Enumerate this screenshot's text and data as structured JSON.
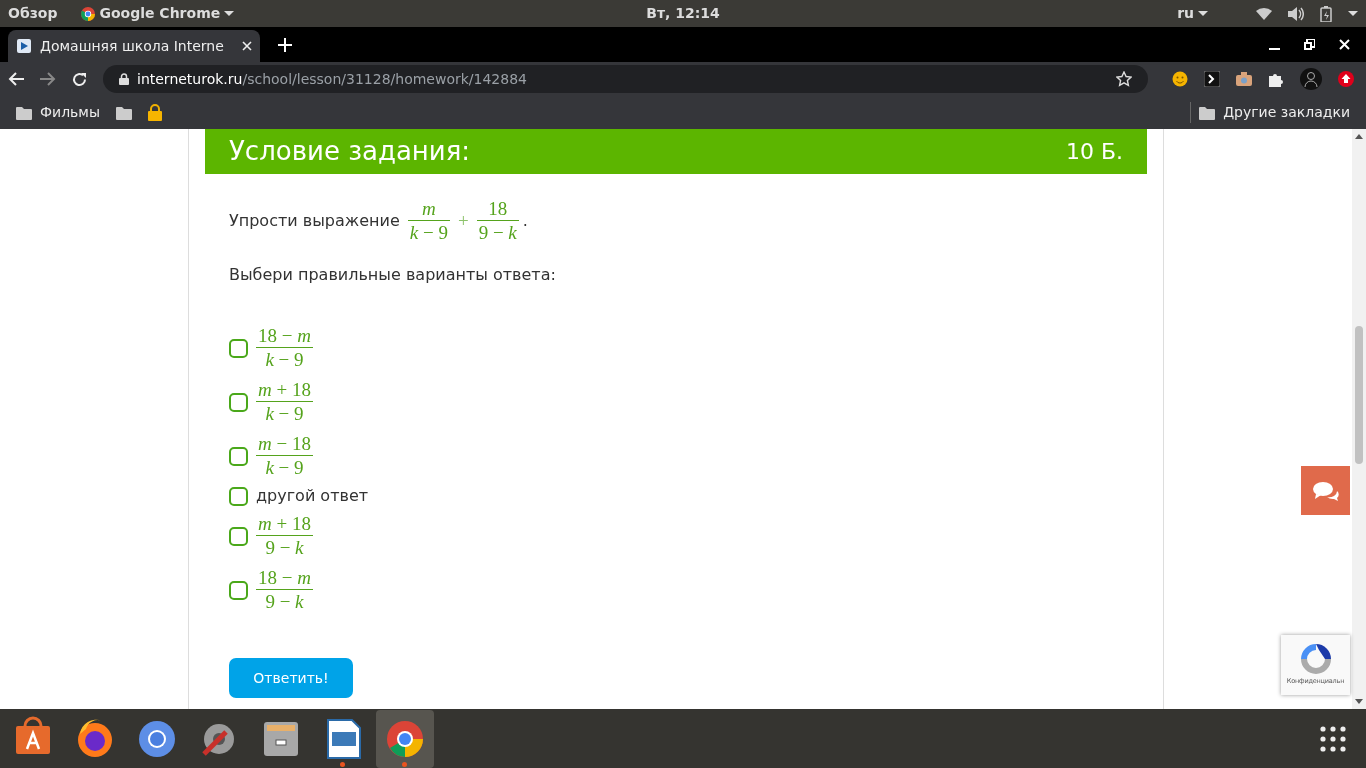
{
  "top_bar": {
    "activities": "Обзор",
    "app_menu": "Google Chrome",
    "clock": "Вт, 12:14",
    "keyboard_layout": "ru"
  },
  "tabs": [
    {
      "title": "Домашняя школа Interne",
      "selected": true
    }
  ],
  "address_bar": {
    "host": "interneturok.ru",
    "path": "/school/lesson/31128/homework/142884"
  },
  "bookmarks": [
    {
      "kind": "folder",
      "label": "Фильмы"
    },
    {
      "kind": "folder"
    },
    {
      "kind": "lock"
    }
  ],
  "other_bookmarks": "Другие закладки",
  "task": {
    "title": "Условие задания:",
    "points": "10 Б.",
    "prompt": "Упрости выражение",
    "expression": {
      "terms": [
        {
          "num": "*m*",
          "den": "*k* − 9"
        },
        {
          "num": "18",
          "den": "9 − *k*"
        }
      ],
      "operator": "+",
      "end": "."
    },
    "instruction": "Выбери правильные варианты ответа:",
    "options": [
      {
        "kind": "fraction",
        "num": "18 − *m*",
        "den": "*k* − 9",
        "checked": false
      },
      {
        "kind": "fraction",
        "num": "*m* + 18",
        "den": "*k* − 9",
        "checked": false
      },
      {
        "kind": "fraction",
        "num": "*m* − 18",
        "den": "*k* − 9",
        "checked": false
      },
      {
        "kind": "text",
        "text": "другой ответ",
        "checked": false
      },
      {
        "kind": "fraction",
        "num": "*m* + 18",
        "den": "9 − *k*",
        "checked": false
      },
      {
        "kind": "fraction",
        "num": "18 − *m*",
        "den": "9 − *k*",
        "checked": false
      }
    ],
    "submit": "Ответить!"
  },
  "recaptcha": {
    "label": "Конфиденциальн"
  },
  "taskbar": [
    {
      "kind": "store",
      "running": false,
      "selected": false
    },
    {
      "kind": "firefox",
      "running": false,
      "selected": false
    },
    {
      "kind": "chromium",
      "running": false,
      "selected": false
    },
    {
      "kind": "settings",
      "running": false,
      "selected": false
    },
    {
      "kind": "files",
      "running": false,
      "selected": false
    },
    {
      "kind": "impress",
      "running": true,
      "selected": false
    },
    {
      "kind": "chrome",
      "running": true,
      "selected": true
    }
  ]
}
